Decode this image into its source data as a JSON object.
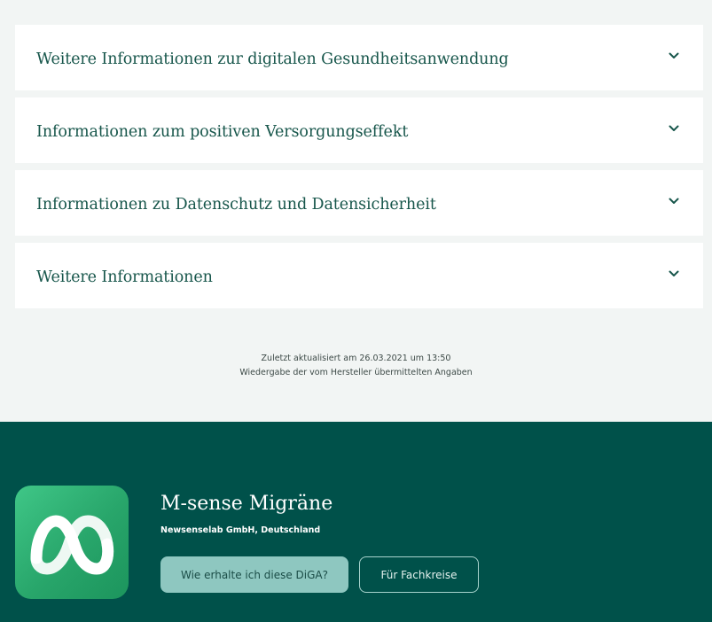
{
  "accordions": [
    {
      "label": "Weitere Informationen zur digitalen Gesundheitsanwendung",
      "icon": "chevron-down-icon"
    },
    {
      "label": "Informationen zum positiven Versorgungseffekt",
      "icon": "chevron-down-icon"
    },
    {
      "label": "Informationen zu Datenschutz und Datensicherheit",
      "icon": "chevron-down-icon"
    },
    {
      "label": "Weitere Informationen",
      "icon": "chevron-down-icon"
    }
  ],
  "meta": {
    "updated": "Zuletzt aktualisiert am 26.03.2021 um 13:50",
    "source": "Wiedergabe der vom Hersteller übermittelten Angaben"
  },
  "app": {
    "icon": "m-sense-logo-icon",
    "title": "M-sense Migräne",
    "manufacturer": "Newsenselab GmbH, Deutschland",
    "primary_button": "Wie erhalte ich diese DiGA?",
    "secondary_button": "Für Fachkreise"
  },
  "colors": {
    "background": "#f2f5f4",
    "accent_text": "#17564b",
    "footer": "#00514a",
    "primary_button": "#8ec7c0",
    "icon_green": "#2fc27d"
  }
}
